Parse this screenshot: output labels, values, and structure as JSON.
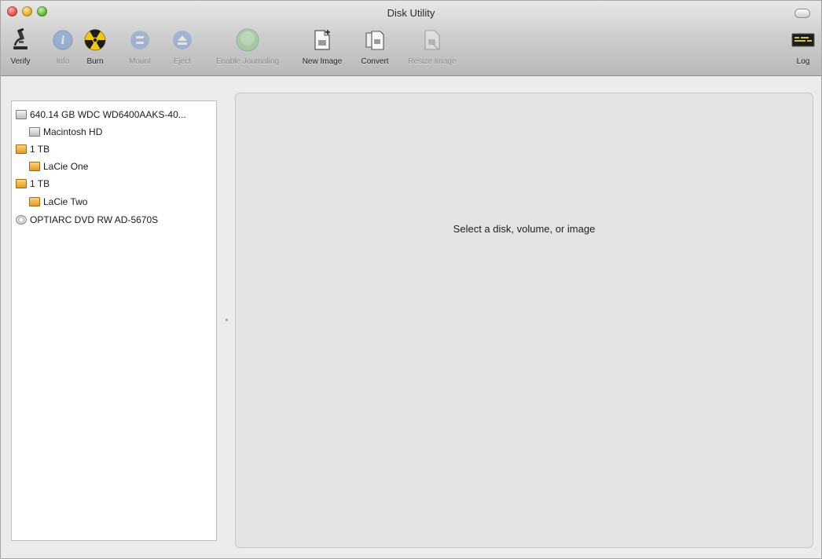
{
  "window": {
    "title": "Disk Utility"
  },
  "toolbar": {
    "verify": "Verify",
    "info": "Info",
    "burn": "Burn",
    "mount": "Mount",
    "eject": "Eject",
    "enable_journaling": "Enable Journaling",
    "new_image": "New Image",
    "convert": "Convert",
    "resize_image": "Resize Image",
    "log": "Log"
  },
  "sidebar": {
    "items": [
      {
        "label": "640.14 GB WDC WD6400AAKS-40...",
        "icon": "hard-disk-icon"
      },
      {
        "label": "Macintosh HD",
        "icon": "hard-disk-icon"
      },
      {
        "label": "1 TB",
        "icon": "external-disk-icon"
      },
      {
        "label": "LaCie One",
        "icon": "external-disk-icon"
      },
      {
        "label": "1 TB",
        "icon": "external-disk-icon"
      },
      {
        "label": "LaCie Two",
        "icon": "external-disk-icon"
      },
      {
        "label": "OPTIARC DVD RW AD-5670S",
        "icon": "optical-drive-icon"
      }
    ]
  },
  "detail": {
    "message": "Select a disk, volume, or image"
  },
  "colors": {
    "close": "#e24b3c",
    "minimize": "#e0a521",
    "zoom": "#5cb02f",
    "external_disk": "#e09a25",
    "info_blue": "#5b8fd6"
  }
}
